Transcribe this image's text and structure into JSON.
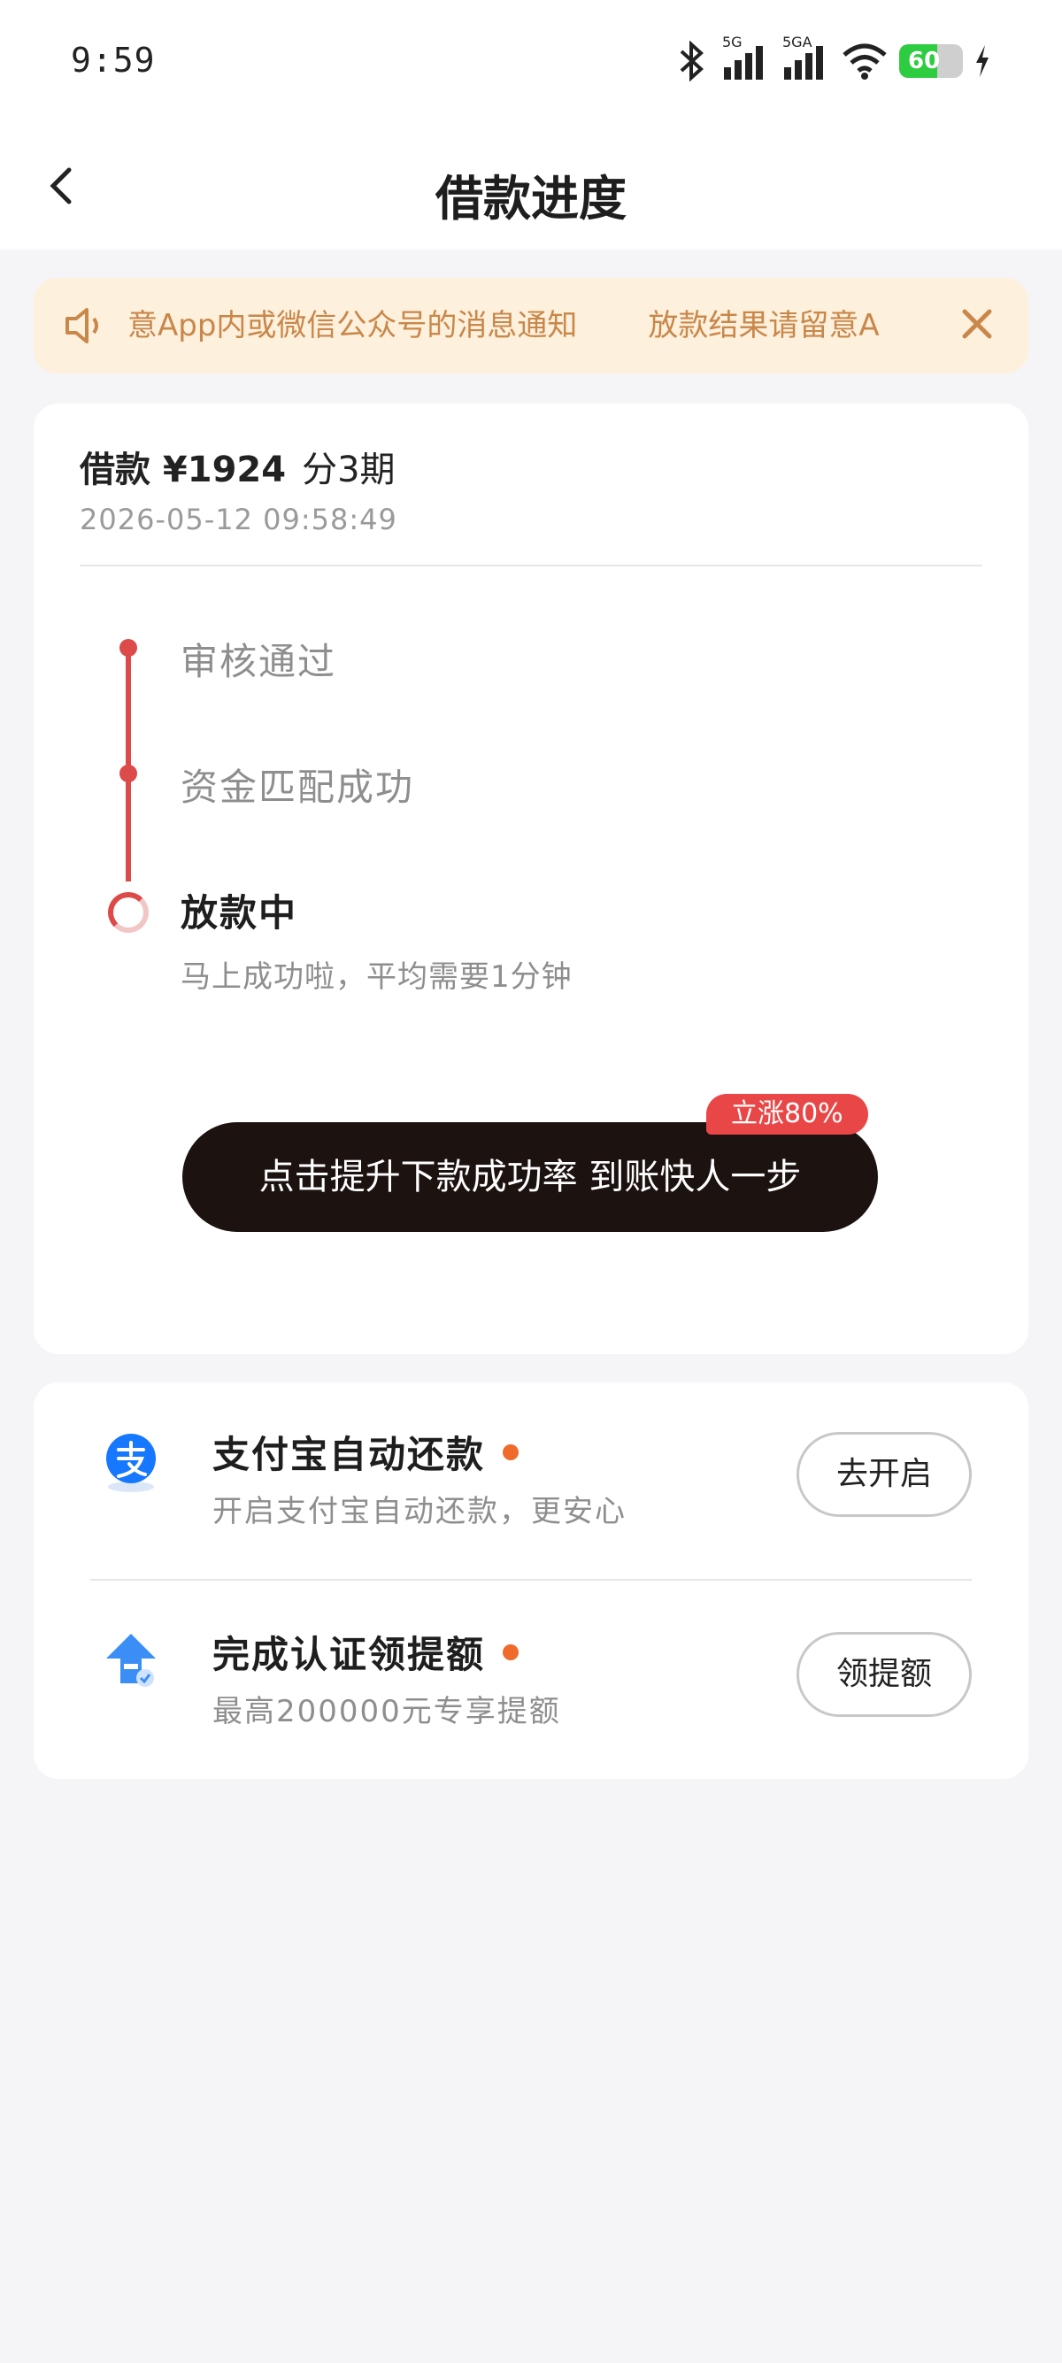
{
  "status_bar": {
    "time": "9:59",
    "battery": "60",
    "signal1_label": "5G",
    "signal2_label": "5GA",
    "battery_level_percent": 60
  },
  "nav": {
    "title": "借款进度"
  },
  "notice": {
    "text_a": "意App内或微信公众号的消息通知",
    "text_b": "放款结果请留意A"
  },
  "loan": {
    "amount": "借款 ¥1924",
    "periods": "分3期",
    "datetime": "2026-05-12 09:58:49"
  },
  "progress": {
    "steps": [
      {
        "label": "审核通过",
        "state": "done"
      },
      {
        "label": "资金匹配成功",
        "state": "done"
      },
      {
        "label": "放款中",
        "state": "active",
        "sub": "马上成功啦，平均需要1分钟"
      }
    ]
  },
  "boost": {
    "button_label": "点击提升下款成功率 到账快人一步",
    "tag": "立涨80%"
  },
  "services": [
    {
      "name": "支付宝自动还款",
      "desc": "开启支付宝自动还款，更安心",
      "button": "去开启",
      "icon": "alipay-icon"
    },
    {
      "name": "完成认证领提额",
      "desc": "最高200000元专享提额",
      "button": "领提额",
      "icon": "credit-up-icon"
    }
  ],
  "colors": {
    "accent_red": "#dc4a4a",
    "notice_bg": "#fdf0dc",
    "notice_text": "#c9874a",
    "button_dark": "#1c1210",
    "badge_orange": "#f06a2c"
  }
}
